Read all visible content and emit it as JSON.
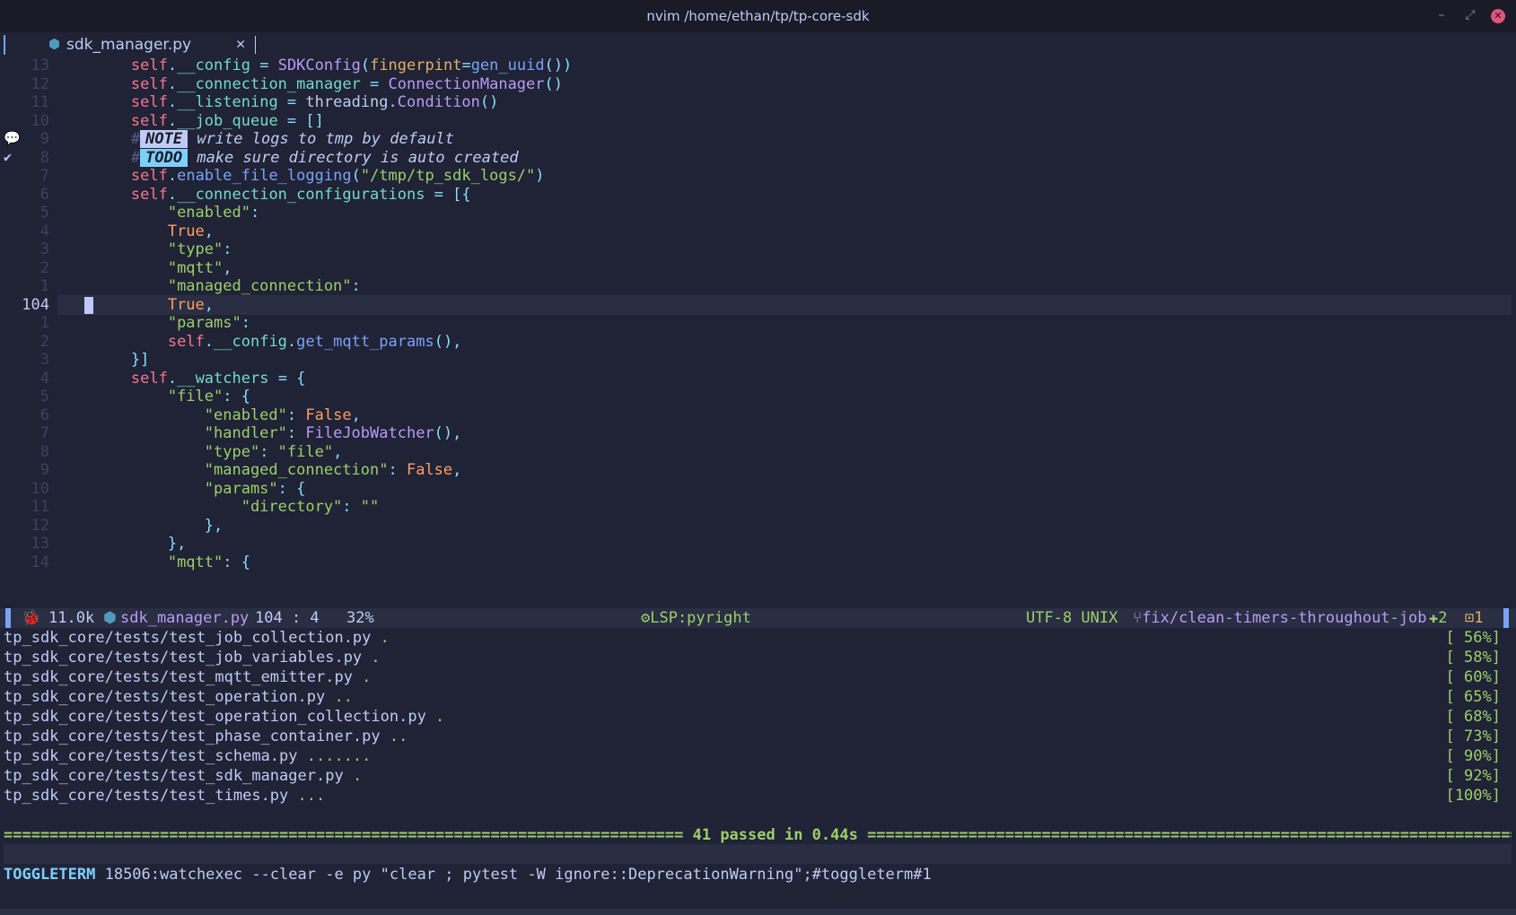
{
  "window": {
    "title": "nvim /home/ethan/tp/tp-core-sdk",
    "minimize_icon": "–",
    "maximize_icon": "⤢",
    "close_icon": "✕"
  },
  "tabline": {
    "tabs": [
      {
        "label": "sdk_manager.py",
        "icon": "python-icon",
        "close": "✕"
      }
    ]
  },
  "editor": {
    "current_line": "104",
    "lines": [
      {
        "num": "13",
        "tokens": [
          [
            "k-plain",
            "        "
          ],
          [
            "k-self",
            "self"
          ],
          [
            "k-op",
            "."
          ],
          [
            "k-attr",
            "__config"
          ],
          [
            "k-op",
            " = "
          ],
          [
            "k-cls",
            "SDKConfig"
          ],
          [
            "k-op",
            "("
          ],
          [
            "k-param",
            "fingerpint"
          ],
          [
            "k-op",
            "="
          ],
          [
            "k-fn",
            "gen_uuid"
          ],
          [
            "k-op",
            "())"
          ]
        ]
      },
      {
        "num": "12",
        "tokens": [
          [
            "k-plain",
            "        "
          ],
          [
            "k-self",
            "self"
          ],
          [
            "k-op",
            "."
          ],
          [
            "k-attr",
            "__connection_manager"
          ],
          [
            "k-op",
            " = "
          ],
          [
            "k-cls",
            "ConnectionManager"
          ],
          [
            "k-op",
            "()"
          ]
        ]
      },
      {
        "num": "11",
        "tokens": [
          [
            "k-plain",
            "        "
          ],
          [
            "k-self",
            "self"
          ],
          [
            "k-op",
            "."
          ],
          [
            "k-attr",
            "__listening"
          ],
          [
            "k-op",
            " = "
          ],
          [
            "k-plain",
            "threading"
          ],
          [
            "k-op",
            "."
          ],
          [
            "k-cls",
            "Condition"
          ],
          [
            "k-op",
            "()"
          ]
        ]
      },
      {
        "num": "10",
        "tokens": [
          [
            "k-plain",
            "        "
          ],
          [
            "k-self",
            "self"
          ],
          [
            "k-op",
            "."
          ],
          [
            "k-attr",
            "__job_queue"
          ],
          [
            "k-op",
            " = []"
          ]
        ]
      },
      {
        "num": "9",
        "sign": "💬",
        "tokens": [
          [
            "k-plain",
            "        "
          ],
          [
            "k-hash",
            "#"
          ],
          [
            "badge note",
            "NOTE"
          ],
          [
            "k-cm",
            " write logs to tmp by default"
          ]
        ]
      },
      {
        "num": "8",
        "sign": "✔",
        "tokens": [
          [
            "k-plain",
            "        "
          ],
          [
            "k-hash",
            "#"
          ],
          [
            "badge todo",
            "TODO"
          ],
          [
            "k-cm",
            " make sure directory is auto created"
          ]
        ]
      },
      {
        "num": "7",
        "tokens": [
          [
            "k-plain",
            "        "
          ],
          [
            "k-self",
            "self"
          ],
          [
            "k-op",
            "."
          ],
          [
            "k-fn",
            "enable_file_logging"
          ],
          [
            "k-op",
            "("
          ],
          [
            "k-str",
            "\"/tmp/tp_sdk_logs/\""
          ],
          [
            "k-op",
            ")"
          ]
        ]
      },
      {
        "num": "6",
        "tokens": [
          [
            "k-plain",
            "        "
          ],
          [
            "k-self",
            "self"
          ],
          [
            "k-op",
            "."
          ],
          [
            "k-attr",
            "__connection_configurations"
          ],
          [
            "k-op",
            " = [{"
          ]
        ]
      },
      {
        "num": "5",
        "tokens": [
          [
            "k-plain",
            "            "
          ],
          [
            "k-str",
            "\"enabled\""
          ],
          [
            "k-op",
            ":"
          ]
        ]
      },
      {
        "num": "4",
        "tokens": [
          [
            "k-plain",
            "            "
          ],
          [
            "k-bool",
            "True"
          ],
          [
            "k-op",
            ","
          ]
        ]
      },
      {
        "num": "3",
        "tokens": [
          [
            "k-plain",
            "            "
          ],
          [
            "k-str",
            "\"type\""
          ],
          [
            "k-op",
            ":"
          ]
        ]
      },
      {
        "num": "2",
        "tokens": [
          [
            "k-plain",
            "            "
          ],
          [
            "k-str",
            "\"mqtt\""
          ],
          [
            "k-op",
            ","
          ]
        ]
      },
      {
        "num": "1",
        "tokens": [
          [
            "k-plain",
            "            "
          ],
          [
            "k-str",
            "\"managed_connection\""
          ],
          [
            "k-op",
            ":"
          ]
        ]
      },
      {
        "num": "104",
        "current": true,
        "tokens": [
          [
            "k-plain",
            "            "
          ],
          [
            "k-bool",
            "True"
          ],
          [
            "k-op",
            ","
          ]
        ]
      },
      {
        "num": "1",
        "tokens": [
          [
            "k-plain",
            "            "
          ],
          [
            "k-str",
            "\"params\""
          ],
          [
            "k-op",
            ":"
          ]
        ]
      },
      {
        "num": "2",
        "tokens": [
          [
            "k-plain",
            "            "
          ],
          [
            "k-self",
            "self"
          ],
          [
            "k-op",
            "."
          ],
          [
            "k-attr",
            "__config"
          ],
          [
            "k-op",
            "."
          ],
          [
            "k-fn",
            "get_mqtt_params"
          ],
          [
            "k-op",
            "(),"
          ]
        ]
      },
      {
        "num": "3",
        "tokens": [
          [
            "k-plain",
            "        "
          ],
          [
            "k-op",
            "}]"
          ]
        ]
      },
      {
        "num": "4",
        "tokens": [
          [
            "k-plain",
            "        "
          ],
          [
            "k-self",
            "self"
          ],
          [
            "k-op",
            "."
          ],
          [
            "k-attr",
            "__watchers"
          ],
          [
            "k-op",
            " = {"
          ]
        ]
      },
      {
        "num": "5",
        "tokens": [
          [
            "k-plain",
            "            "
          ],
          [
            "k-str",
            "\"file\""
          ],
          [
            "k-op",
            ": {"
          ]
        ]
      },
      {
        "num": "6",
        "tokens": [
          [
            "k-plain",
            "                "
          ],
          [
            "k-str",
            "\"enabled\""
          ],
          [
            "k-op",
            ": "
          ],
          [
            "k-bool",
            "False"
          ],
          [
            "k-op",
            ","
          ]
        ]
      },
      {
        "num": "7",
        "tokens": [
          [
            "k-plain",
            "                "
          ],
          [
            "k-str",
            "\"handler\""
          ],
          [
            "k-op",
            ": "
          ],
          [
            "k-cls",
            "FileJobWatcher"
          ],
          [
            "k-op",
            "(),"
          ]
        ]
      },
      {
        "num": "8",
        "tokens": [
          [
            "k-plain",
            "                "
          ],
          [
            "k-str",
            "\"type\""
          ],
          [
            "k-op",
            ": "
          ],
          [
            "k-str",
            "\"file\""
          ],
          [
            "k-op",
            ","
          ]
        ]
      },
      {
        "num": "9",
        "tokens": [
          [
            "k-plain",
            "                "
          ],
          [
            "k-str",
            "\"managed_connection\""
          ],
          [
            "k-op",
            ": "
          ],
          [
            "k-bool",
            "False"
          ],
          [
            "k-op",
            ","
          ]
        ]
      },
      {
        "num": "10",
        "tokens": [
          [
            "k-plain",
            "                "
          ],
          [
            "k-str",
            "\"params\""
          ],
          [
            "k-op",
            ": {"
          ]
        ]
      },
      {
        "num": "11",
        "tokens": [
          [
            "k-plain",
            "                    "
          ],
          [
            "k-str",
            "\"directory\""
          ],
          [
            "k-op",
            ": "
          ],
          [
            "k-str",
            "\"\""
          ]
        ]
      },
      {
        "num": "12",
        "tokens": [
          [
            "k-plain",
            "                "
          ],
          [
            "k-op",
            "},"
          ]
        ]
      },
      {
        "num": "13",
        "tokens": [
          [
            "k-plain",
            "            "
          ],
          [
            "k-op",
            "},"
          ]
        ]
      },
      {
        "num": "14",
        "tokens": [
          [
            "k-plain",
            "            "
          ],
          [
            "k-str",
            "\"mqtt\""
          ],
          [
            "k-op",
            ": {"
          ]
        ]
      }
    ]
  },
  "statusline": {
    "mode_icon": "🐞",
    "file_size": "11.0k",
    "file_icon": "python-icon",
    "file_name": "sdk_manager.py",
    "position": "104 : 4",
    "percent": "32%",
    "lsp": "⚙LSP:pyright",
    "encoding": "UTF-8 UNIX",
    "branch": "⑂fix/clean-timers-throughout-job",
    "diff_added": "✚2",
    "diff_changed": "⊡1"
  },
  "terminal": {
    "rows": [
      {
        "path": "tp_sdk_core/tests/test_job_collection.py",
        "dots": " .",
        "pct": "[ 56%]"
      },
      {
        "path": "tp_sdk_core/tests/test_job_variables.py",
        "dots": " .",
        "pct": "[ 58%]"
      },
      {
        "path": "tp_sdk_core/tests/test_mqtt_emitter.py",
        "dots": " .",
        "pct": "[ 60%]"
      },
      {
        "path": "tp_sdk_core/tests/test_operation.py",
        "dots": " ..",
        "pct": "[ 65%]"
      },
      {
        "path": "tp_sdk_core/tests/test_operation_collection.py",
        "dots": " .",
        "pct": "[ 68%]"
      },
      {
        "path": "tp_sdk_core/tests/test_phase_container.py",
        "dots": " ..",
        "pct": "[ 73%]"
      },
      {
        "path": "tp_sdk_core/tests/test_schema.py",
        "dots": " .......",
        "pct": "[ 90%]"
      },
      {
        "path": "tp_sdk_core/tests/test_sdk_manager.py",
        "dots": " .",
        "pct": "[ 92%]"
      },
      {
        "path": "tp_sdk_core/tests/test_times.py",
        "dots": " ...",
        "pct": "[100%]"
      }
    ],
    "summary": "========================================================================== 41 passed in 0.44s ===========================================================================",
    "toggleterm_label": "TOGGLETERM",
    "command": " 18506:watchexec --clear -e py \"clear ; pytest -W ignore::DeprecationWarning\";#toggleterm#1"
  },
  "colors": {
    "background": "#1f2335",
    "accent": "#7aa2f7",
    "string": "#9ece6a",
    "keyword": "#f7768e",
    "class": "#bb9af7"
  }
}
